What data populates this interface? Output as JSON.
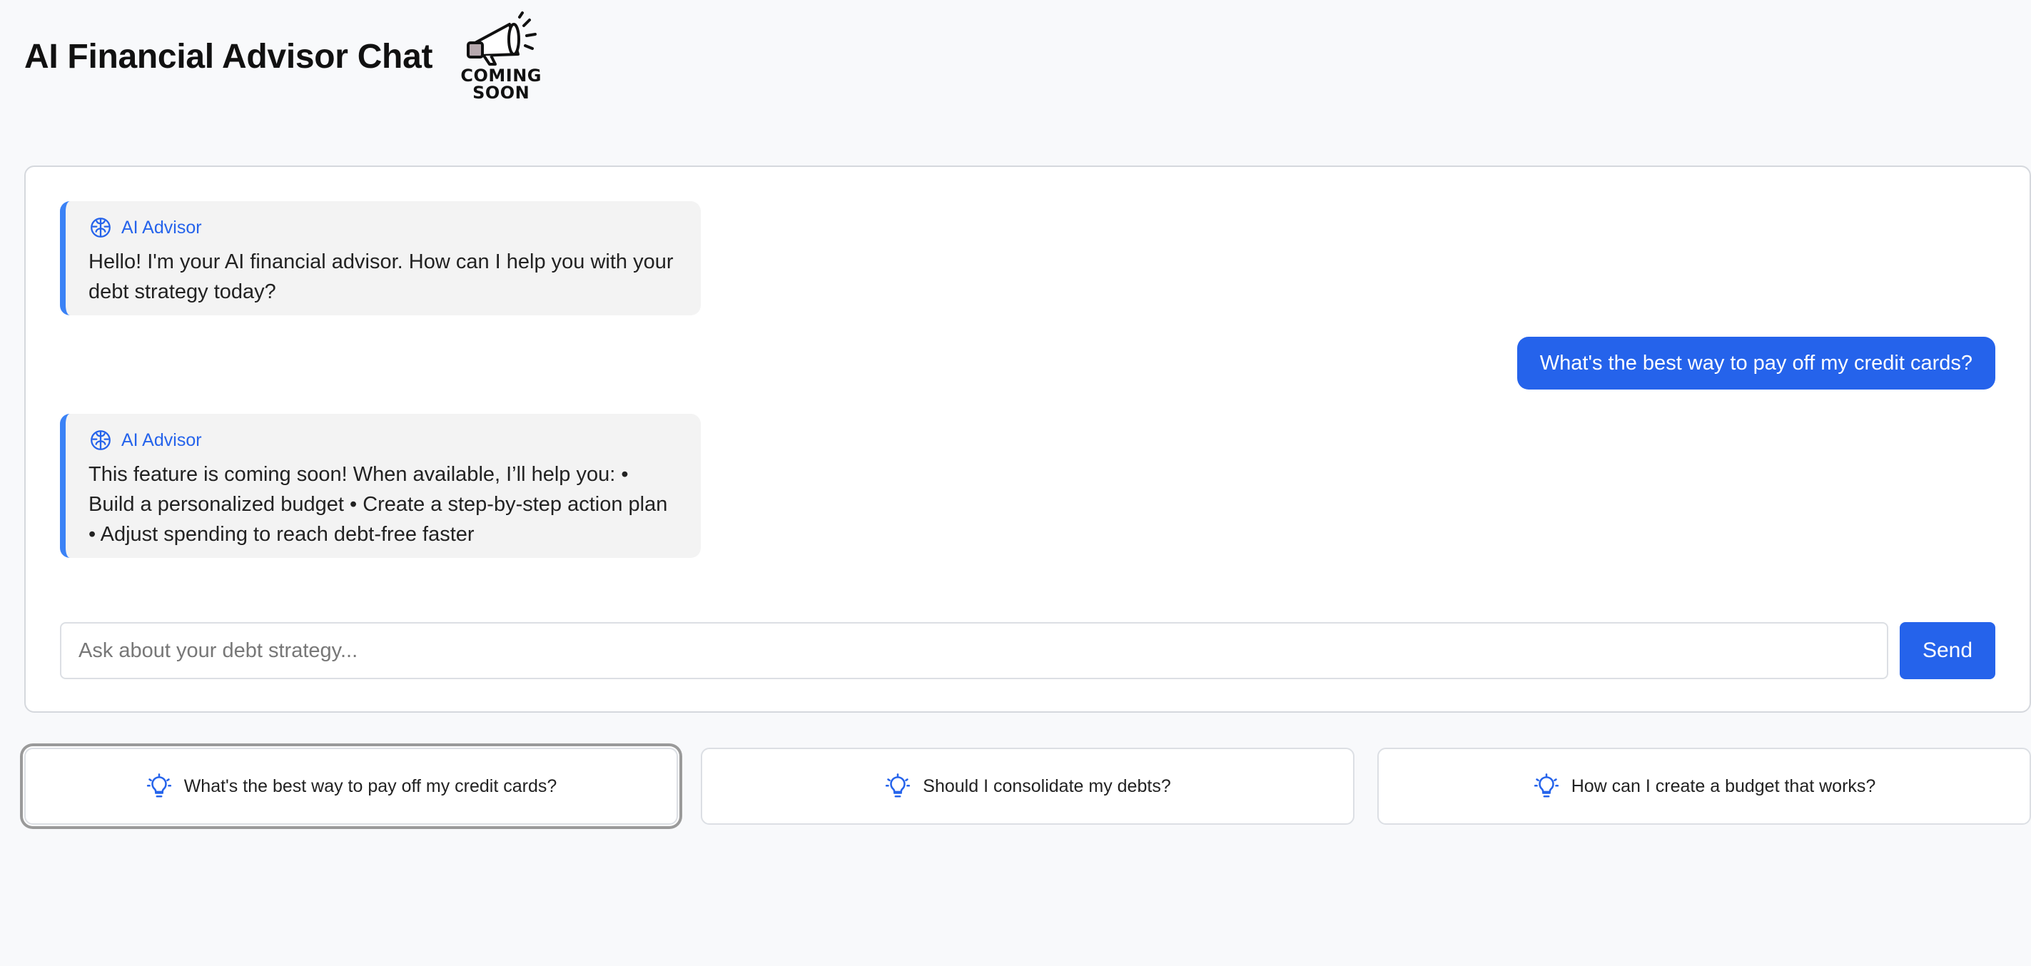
{
  "header": {
    "title": "AI Financial Advisor Chat",
    "badge": {
      "icon": "megaphone-icon",
      "line1": "COMING",
      "line2": "SOON"
    }
  },
  "chat": {
    "messages": [
      {
        "role": "ai",
        "sender": "AI Advisor",
        "icon": "brain-icon",
        "text": "Hello! I'm your AI financial advisor. How can I help you with your debt strategy today?"
      },
      {
        "role": "user",
        "text": "What's the best way to pay off my credit cards?"
      },
      {
        "role": "ai",
        "sender": "AI Advisor",
        "icon": "brain-icon",
        "text": "This feature is coming soon! When available, I’ll help you: • Build a personalized budget • Create a step-by-step action plan • Adjust spending to reach debt-free faster"
      }
    ],
    "input": {
      "placeholder": "Ask about your debt strategy...",
      "value": ""
    },
    "send_label": "Send"
  },
  "suggestions": [
    {
      "icon": "lightbulb-icon",
      "label": "What's the best way to pay off my credit cards?",
      "focused": true
    },
    {
      "icon": "lightbulb-icon",
      "label": "Should I consolidate my debts?",
      "focused": false
    },
    {
      "icon": "lightbulb-icon",
      "label": "How can I create a budget that works?",
      "focused": false
    }
  ],
  "colors": {
    "accent": "#2563eb",
    "ai_border": "#3b82f6",
    "background": "#f8f9fb",
    "ai_bubble": "#f3f3f3"
  }
}
